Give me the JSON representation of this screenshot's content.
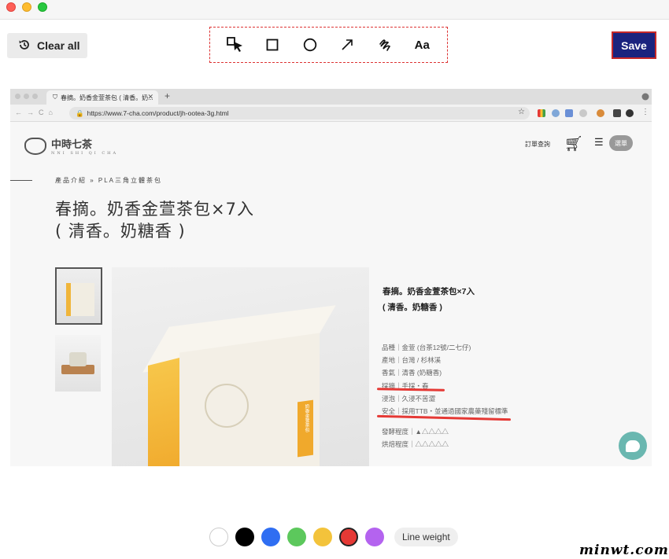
{
  "window": {
    "controls": [
      "close",
      "minimize",
      "zoom"
    ]
  },
  "clear_all": {
    "label": "Clear all",
    "icon": "history-icon"
  },
  "tools": [
    {
      "name": "select-tool",
      "icon": "cursor-icon",
      "label": ""
    },
    {
      "name": "rectangle-tool",
      "icon": "square-icon",
      "label": ""
    },
    {
      "name": "ellipse-tool",
      "icon": "circle-icon",
      "label": ""
    },
    {
      "name": "arrow-tool",
      "icon": "arrow-icon",
      "label": ""
    },
    {
      "name": "pen-tool",
      "icon": "scribble-icon",
      "label": ""
    },
    {
      "name": "text-tool",
      "icon": "text-icon",
      "label": "Aa"
    }
  ],
  "save": {
    "label": "Save"
  },
  "screenshot": {
    "tab_title": "春摘。奶香金萱茶包 ( 清香。奶...",
    "url": "https://www.7-cha.com/product/jh-ootea-3g.html",
    "site": {
      "logo_text": "中時七茶",
      "logo_sub": "NNI SHI QI CHA",
      "order_query": "訂單查詢",
      "menu_pill": "選單"
    },
    "breadcrumb": "產品介紹 » PLA三角立體茶包",
    "product_title_line1": "春摘。奶香金萱茶包×7入",
    "product_title_line2": "( 清香。奶糖香 )",
    "info_title_line1": "春摘。奶香金萱茶包×7入",
    "info_title_line2": "( 清香。奶糖香 )",
    "box_label": "奶香金萱茶包",
    "specs": [
      "品種｜金萱 (台茶12號/二七仔)",
      "產地｜台灣 / 杉林溪",
      "香氣｜清香 (奶糖香)",
      "採摘｜手採・春",
      "浸泡｜久浸不苦澀",
      "安全｜採用TTB・並通過國家農藥殘留標準"
    ],
    "levels": [
      "發酵程度｜▲△△△△",
      "烘焙程度｜△△△△△"
    ]
  },
  "palette": {
    "colors": [
      "#ffffff",
      "#000000",
      "#2f6ef2",
      "#5cc85c",
      "#f3c33b",
      "#e53935",
      "#b463ef"
    ],
    "selected": "#e53935",
    "line_weight_label": "Line weight"
  },
  "watermark": "minwt.com",
  "annotation_color": "#e53935"
}
